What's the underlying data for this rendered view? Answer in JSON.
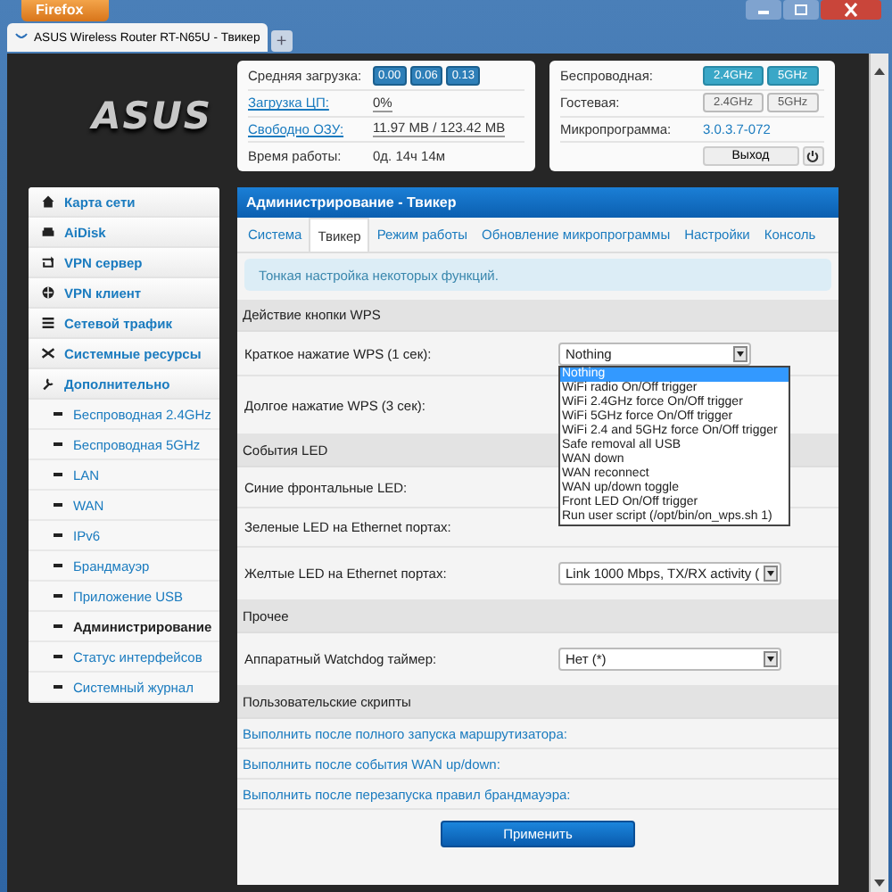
{
  "browser": {
    "menu_button": "Firefox",
    "tab_title": "ASUS Wireless Router RT-N65U - Твикер",
    "new_tab": "+"
  },
  "header": {
    "logo": "ASUS",
    "status": [
      {
        "label": "Средняя загрузка:",
        "link": false,
        "badges": [
          "0.00",
          "0.06",
          "0.13"
        ]
      },
      {
        "label": "Загрузка ЦП:",
        "link": true,
        "value": "0%"
      },
      {
        "label": "Свободно ОЗУ:",
        "link": true,
        "value": "11.97 MB / 123.42 MB"
      },
      {
        "label": "Время работы:",
        "link": false,
        "value": "0д. 14ч 14м"
      }
    ],
    "wireless": [
      {
        "label": "Беспроводная:",
        "kind": "toggles",
        "toggles": [
          {
            "label": "2.4GHz",
            "on": true
          },
          {
            "label": "5GHz",
            "on": true
          }
        ]
      },
      {
        "label": "Гостевая:",
        "kind": "toggles",
        "toggles": [
          {
            "label": "2.4GHz",
            "on": false
          },
          {
            "label": "5GHz",
            "on": false
          }
        ]
      },
      {
        "label": "Микропрограмма:",
        "kind": "link",
        "value": "3.0.3.7-072"
      },
      {
        "kind": "logout",
        "value": "Выход"
      }
    ]
  },
  "sidebar": {
    "items": [
      {
        "label": "Карта сети",
        "selected": false
      },
      {
        "label": "AiDisk",
        "selected": false
      },
      {
        "label": "VPN сервер",
        "selected": false
      },
      {
        "label": "VPN клиент",
        "selected": false
      },
      {
        "label": "Сетевой трафик",
        "selected": false
      },
      {
        "label": "Системные ресурсы",
        "selected": false
      },
      {
        "label": "Дополнительно",
        "selected": false,
        "expanded": true,
        "children": [
          {
            "label": "Беспроводная 2.4GHz",
            "selected": false
          },
          {
            "label": "Беспроводная 5GHz",
            "selected": false
          },
          {
            "label": "LAN",
            "selected": false
          },
          {
            "label": "WAN",
            "selected": false
          },
          {
            "label": "IPv6",
            "selected": false
          },
          {
            "label": "Брандмауэр",
            "selected": false
          },
          {
            "label": "Приложение USB",
            "selected": false
          },
          {
            "label": "Администрирование",
            "selected": true
          },
          {
            "label": "Статус интерфейсов",
            "selected": false
          },
          {
            "label": "Системный журнал",
            "selected": false
          }
        ]
      }
    ]
  },
  "main": {
    "title": "Администрирование - Твикер",
    "tabs": [
      {
        "label": "Система",
        "selected": false
      },
      {
        "label": "Твикер",
        "selected": true
      },
      {
        "label": "Режим работы",
        "selected": false
      },
      {
        "label": "Обновление микропрограммы",
        "selected": false
      },
      {
        "label": "Настройки",
        "selected": false
      },
      {
        "label": "Консоль",
        "selected": false
      }
    ],
    "info": "Тонкая настройка некоторых функций.",
    "sections": [
      {
        "title": "Действие кнопки WPS",
        "rows": [
          {
            "label": "Краткое нажатие WPS (1 сек):",
            "kind": "select",
            "value": "Nothing",
            "open": true,
            "options": [
              {
                "label": "Nothing",
                "selected": true
              },
              {
                "label": "WiFi radio On/Off trigger",
                "selected": false
              },
              {
                "label": "WiFi 2.4GHz force On/Off trigger",
                "selected": false
              },
              {
                "label": "WiFi 5GHz force On/Off trigger",
                "selected": false
              },
              {
                "label": "WiFi 2.4 and 5GHz force On/Off trigger",
                "selected": false
              },
              {
                "label": "Safe removal all USB",
                "selected": false
              },
              {
                "label": "WAN down",
                "selected": false
              },
              {
                "label": "WAN reconnect",
                "selected": false
              },
              {
                "label": "WAN up/down toggle",
                "selected": false
              },
              {
                "label": "Front LED On/Off trigger",
                "selected": false
              },
              {
                "label": "Run user script (/opt/bin/on_wps.sh 1)",
                "selected": false
              }
            ]
          },
          {
            "label": "Долгое нажатие WPS (3 сек):",
            "kind": "plain"
          }
        ]
      },
      {
        "title": "События LED",
        "rows": [
          {
            "label": "Синие фронтальные LED:",
            "kind": "plain"
          },
          {
            "label": "Зеленые LED на Ethernet портах:",
            "kind": "plain"
          },
          {
            "label": "Желтые LED на Ethernet портах:",
            "kind": "select",
            "value": "Link 1000 Mbps, TX/RX activity (",
            "open": false
          }
        ]
      },
      {
        "title": "Прочее",
        "rows": [
          {
            "label": "Аппаратный Watchdog таймер:",
            "kind": "select",
            "value": "Нет (*)",
            "open": false
          }
        ]
      },
      {
        "title": "Пользовательские скрипты",
        "rows": [
          {
            "label": "Выполнить после полного запуска маршрутизатора:",
            "kind": "link"
          },
          {
            "label": "Выполнить после события WAN up/down:",
            "kind": "link"
          },
          {
            "label": "Выполнить после перезапуска правил брандмауэра:",
            "kind": "link"
          }
        ]
      }
    ],
    "apply_button": "Применить"
  }
}
